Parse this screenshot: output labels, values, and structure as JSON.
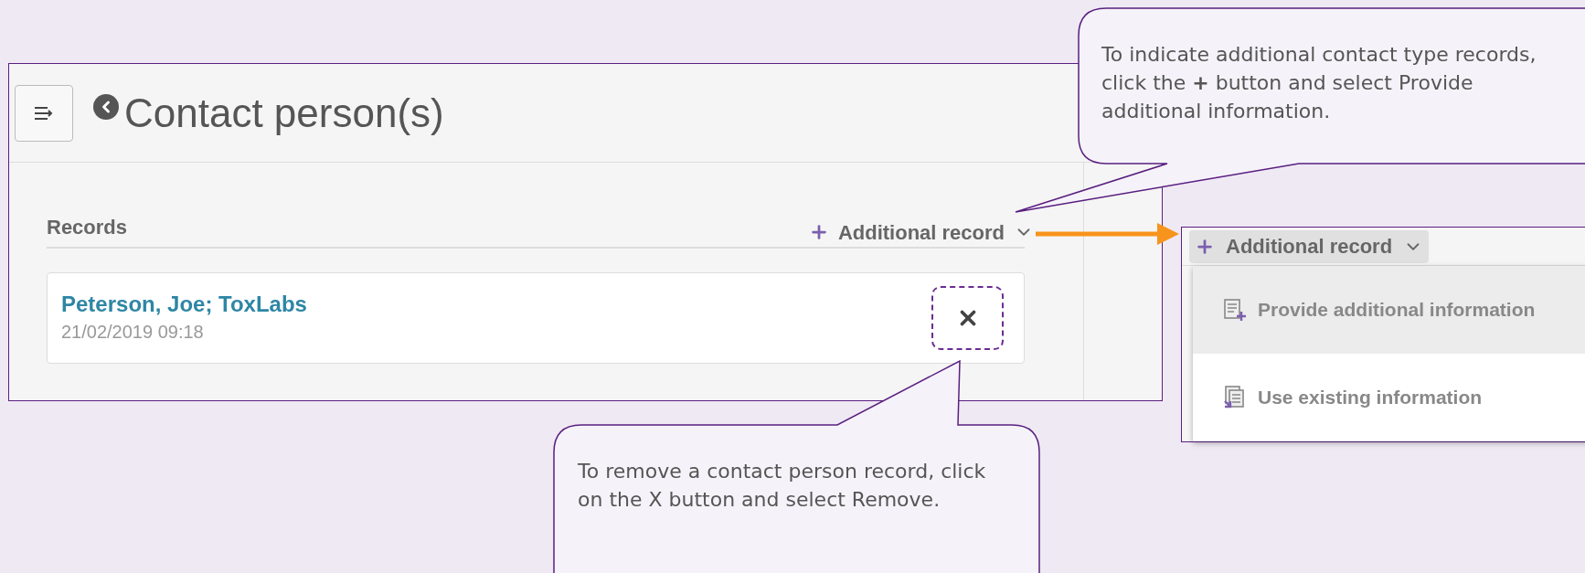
{
  "page": {
    "title": "Contact person(s)",
    "records_label": "Records",
    "add_button": {
      "label": "Additional record"
    },
    "records": [
      {
        "name": "Peterson, Joe; ToxLabs",
        "date": "21/02/2019 09:18"
      }
    ]
  },
  "dropdown_inset": {
    "add_button": {
      "label": "Additional record"
    },
    "menu": [
      {
        "kind": "provide",
        "label": "Provide additional information",
        "highlighted": true
      },
      {
        "kind": "existing",
        "label": "Use existing information",
        "highlighted": false
      }
    ]
  },
  "callouts": [
    {
      "text": "To indicate additional contact type records, click the **+** button and select Provide additional information."
    },
    {
      "text": "To remove a contact person record, click on the X button and select Remove."
    }
  ]
}
